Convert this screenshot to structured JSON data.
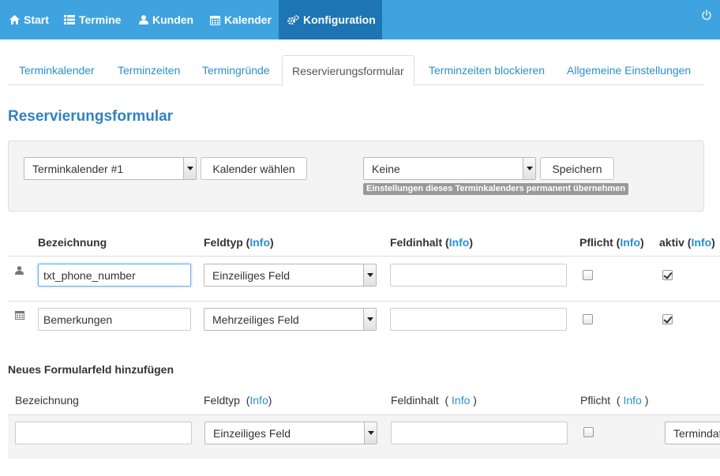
{
  "nav": {
    "items": [
      {
        "label": "Start",
        "icon": "home-icon"
      },
      {
        "label": "Termine",
        "icon": "list-icon"
      },
      {
        "label": "Kunden",
        "icon": "user-icon"
      },
      {
        "label": "Kalender",
        "icon": "calendar-icon"
      },
      {
        "label": "Konfiguration",
        "icon": "cogs-icon",
        "active": true
      }
    ],
    "accent": "#3ea3df",
    "active_color": "#1d75b3"
  },
  "tabs": [
    {
      "label": "Terminkalender"
    },
    {
      "label": "Terminzeiten"
    },
    {
      "label": "Termingründe"
    },
    {
      "label": "Reservierungsformular",
      "active": true
    },
    {
      "label": "Terminzeiten blockieren"
    },
    {
      "label": "Allgemeine Einstellungen"
    }
  ],
  "page_title": "Reservierungsformular",
  "config": {
    "calendar_select": "Terminkalender #1",
    "choose_button": "Kalender wählen",
    "preset_select": "Keine",
    "save_button": "Speichern",
    "hint": "Einstellungen dieses Terminkalenders permanent übernehmen"
  },
  "fields_table": {
    "headers": {
      "name": "Bezeichnung",
      "type": "Feldtyp",
      "content": "Feldinhalt",
      "required": "Pflicht",
      "active": "aktiv",
      "info": "Info"
    },
    "rows": [
      {
        "icon": "user-icon",
        "name": "txt_phone_number",
        "type": "Einzeiliges Feld",
        "content": "",
        "required": false,
        "active": true
      },
      {
        "icon": "calendar-icon",
        "name": "Bemerkungen",
        "type": "Mehrzeiliges Feld",
        "content": "",
        "required": false,
        "active": true
      }
    ]
  },
  "new_field": {
    "title": "Neues Formularfeld hinzufügen",
    "headers": {
      "name": "Bezeichnung",
      "type": "Feldtyp",
      "content": "Feldinhalt",
      "required": "Pflicht",
      "info": "Info"
    },
    "name_value": "",
    "type_value": "Einzeiliges Feld",
    "content_value": "",
    "required": false,
    "extra_select": "Termindat"
  }
}
